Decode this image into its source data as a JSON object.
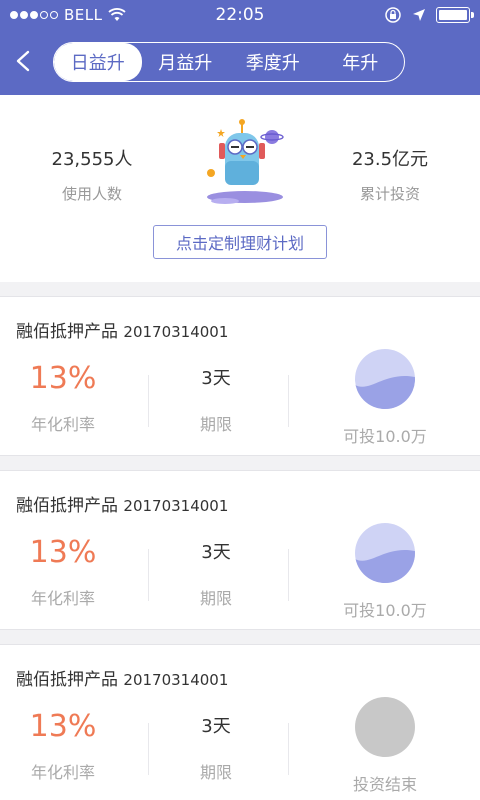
{
  "status_bar": {
    "carrier": "BELL",
    "time": "22:05"
  },
  "tabs": [
    {
      "label": "日益升",
      "active": true
    },
    {
      "label": "月益升",
      "active": false
    },
    {
      "label": "季度升",
      "active": false
    },
    {
      "label": "年升",
      "active": false
    }
  ],
  "summary": {
    "users_value": "23,555人",
    "users_label": "使用人数",
    "invest_value": "23.5亿元",
    "invest_label": "累计投资",
    "plan_button": "点击定制理财计划"
  },
  "products": [
    {
      "name": "融佰抵押产品",
      "code": "20170314001",
      "rate": "13%",
      "rate_label": "年化利率",
      "term": "3天",
      "term_label": "期限",
      "status_label": "可投10.0万",
      "state": "available"
    },
    {
      "name": "融佰抵押产品",
      "code": "20170314001",
      "rate": "13%",
      "rate_label": "年化利率",
      "term": "3天",
      "term_label": "期限",
      "status_label": "可投10.0万",
      "state": "available"
    },
    {
      "name": "融佰抵押产品",
      "code": "20170314001",
      "rate": "13%",
      "rate_label": "年化利率",
      "term": "3天",
      "term_label": "期限",
      "status_label": "投资结束",
      "state": "ended"
    }
  ],
  "colors": {
    "brand": "#5c6ac4",
    "rate": "#ef7a55",
    "progress_fill": "#9aa2e6",
    "progress_bg": "#cfd3f5",
    "ended": "#c8c8c8"
  },
  "icons": [
    "back-icon",
    "wifi-icon",
    "lock-rotation-icon",
    "location-arrow-icon",
    "battery-icon",
    "mascot-robot-icon"
  ]
}
